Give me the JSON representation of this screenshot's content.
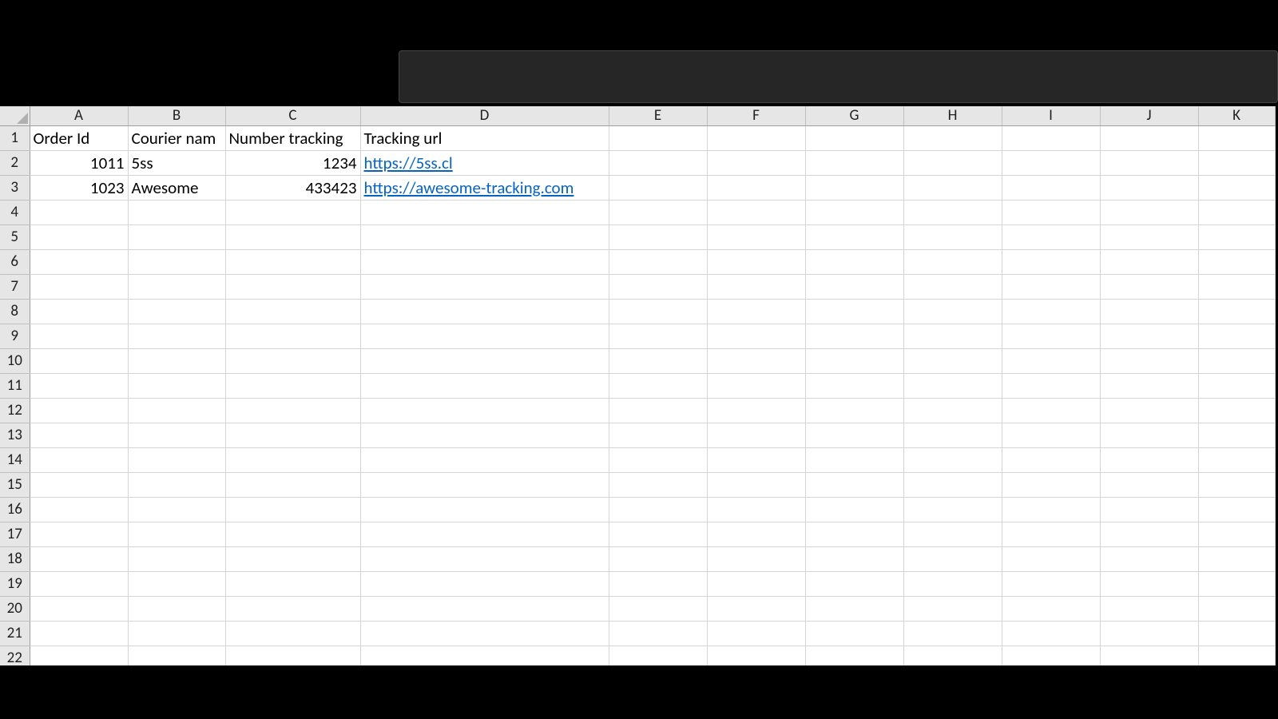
{
  "columns": [
    "A",
    "B",
    "C",
    "D",
    "E",
    "F",
    "G",
    "H",
    "I",
    "J",
    "K"
  ],
  "rowCount": 22,
  "headers": {
    "A": "Order Id",
    "B": "Courier nam",
    "C": "Number tracking",
    "D": "Tracking url"
  },
  "rows": [
    {
      "A": "1011",
      "B": "5ss",
      "C": "1234",
      "D": "https://5ss.cl"
    },
    {
      "A": "1023",
      "B": "Awesome",
      "C": "433423",
      "D": "https://awesome-tracking.com"
    }
  ],
  "colors": {
    "link": "#0563c1",
    "headerBg": "#e6e6e6",
    "gridLine": "#d4d4d4"
  }
}
